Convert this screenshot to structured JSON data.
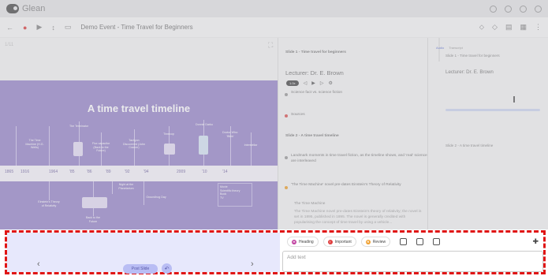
{
  "app": {
    "name": "Glean"
  },
  "toolbar": {
    "title": "Demo Event - Time Travel for Beginners"
  },
  "slide": {
    "page_label": "1/11",
    "title": "A time travel timeline",
    "years": [
      "1865",
      "1916",
      "1964",
      "'85",
      "'86",
      "'89",
      "'92",
      "'94",
      "2009",
      "'10",
      "'14"
    ],
    "labels_top": [
      "The Time Machine (H.G. Wells)",
      "The Terminator",
      "Flux capacitor (Back to the Future)",
      "Tachyon Discovered (John Cramer)",
      "Timecop",
      "Donnie Darko",
      "Doctor Who: 'Blink'",
      "Interstellar"
    ],
    "labels_bottom": [
      "Einstein's Theory of Relativity",
      "Night at the Planetarium",
      "Groundhog Day",
      "Back to the Future",
      "Time Cop"
    ],
    "legend": [
      "Movie",
      "Scientific theory",
      "Book",
      "TV"
    ]
  },
  "transcript": {
    "slide1_heading": "Slide 1 - Time travel for beginners",
    "lecturer": "Lecturer: Dr. E. Brown",
    "speed": "1.0x",
    "note1": "Science fact vs. science fiction",
    "note2": "Sources",
    "slide2_heading": "Slide 2 - A time travel timeline",
    "note3": "Landmark moments in time travel fiction, as the timeline shows, and 'real' science, are interleaved",
    "note4": "'The Time Machine' novel pre-dates Einstein's Theory of Relativity",
    "note4b": "The Time Machine",
    "note4c": "The Time Machine novel pre-dates Einstein's theory of relativity; the novel is set in 1895, published in 1895. The novel is generally credited with popularising the concept of time travel by using a vehicle..."
  },
  "notes_panel": {
    "tab_active": "Audio",
    "tab_other": "Transcript",
    "slide1_heading": "Slide 1 - Time travel for beginners",
    "lecturer": "Lecturer: Dr. E. Brown",
    "slide2_heading": "Slide 2 - A time travel timeline"
  },
  "bottom": {
    "post_slide_label": "Post Slide",
    "prev_icon": "chevron-left-icon",
    "next_icon": "chevron-right-icon",
    "chips": [
      {
        "label": "Heading",
        "icon": "H",
        "color": "#c040a0"
      },
      {
        "label": "Important",
        "icon": "!",
        "color": "#e04040"
      },
      {
        "label": "Review",
        "icon": "R",
        "color": "#f0a030"
      }
    ],
    "input_placeholder": "Add text"
  }
}
